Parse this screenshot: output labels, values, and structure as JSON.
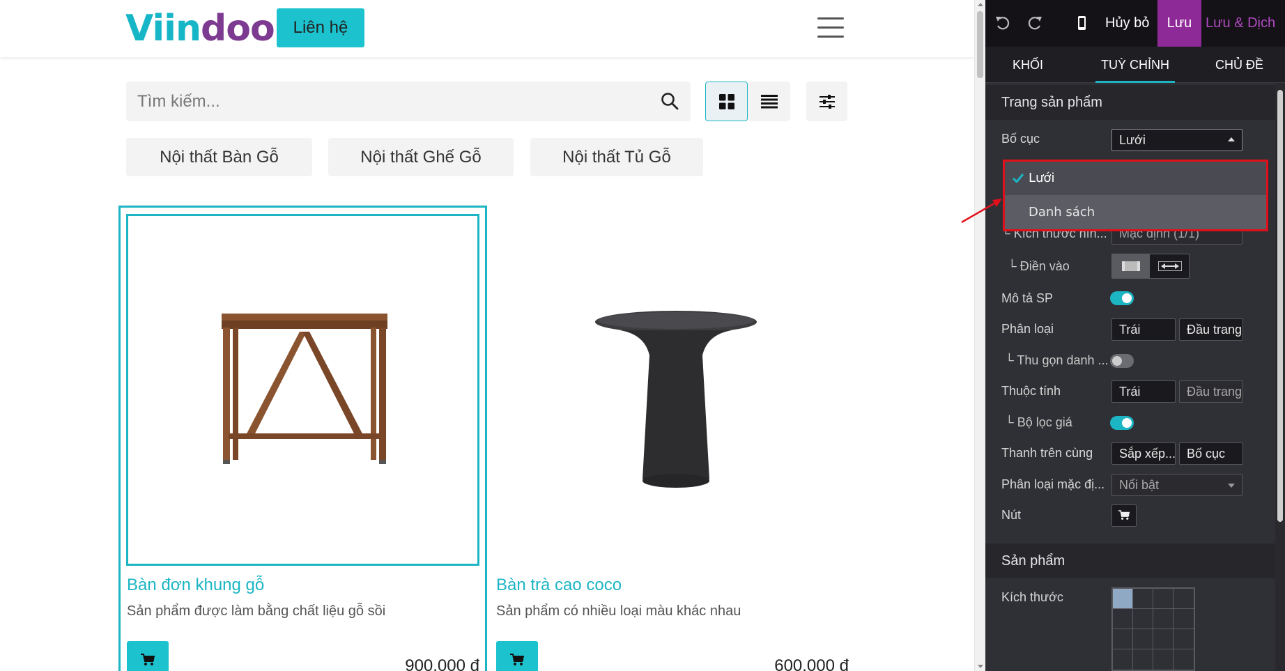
{
  "site": {
    "logo": {
      "part1": "Viin",
      "part2": "doo"
    },
    "contact_label": "Liên hệ",
    "search": {
      "placeholder": "Tìm kiếm..."
    },
    "categories": [
      "Nội thất Bàn Gỗ",
      "Nội thất Ghế Gỗ",
      "Nội thất Tủ Gỗ"
    ],
    "products": [
      {
        "name": "Bàn đơn khung gỗ",
        "desc": "Sản phẩm được làm bằng chất liệu gỗ sồi",
        "price": "900.000 đ"
      },
      {
        "name": "Bàn trà cao coco",
        "desc": "Sản phẩm có nhiều loại màu khác nhau",
        "price": "600.000 đ"
      }
    ],
    "accent_color": "#1cc3cf"
  },
  "editor": {
    "discard_label": "Hủy bỏ",
    "save_label": "Lưu",
    "save_translate_label": "Lưu & Dịch",
    "tabs": [
      "KHỐI",
      "TUỲ CHỈNH",
      "CHỦ ĐỀ"
    ],
    "active_tab": "TUỲ CHỈNH",
    "section_product_page": "Trang sản phẩm",
    "layout_label": "Bố cục",
    "layout_value": "Lưới",
    "layout_options": [
      "Lưới",
      "Danh sách"
    ],
    "image_size_label": "└ Kích thước hìn...",
    "image_size_value": "Mặc định (1/1)",
    "fill_label": "└ Điền vào",
    "desc_label": "Mô tả SP",
    "desc_on": true,
    "category_label": "Phân loại",
    "category_left": "Trái",
    "category_top": "Đầu trang",
    "collapse_label": "└ Thu gọn danh ...",
    "collapse_on": false,
    "attribute_label": "Thuộc tính",
    "attribute_left": "Trái",
    "attribute_top": "Đầu trang",
    "price_filter_label": "└ Bộ lọc giá",
    "price_filter_on": true,
    "topbar_label": "Thanh trên cùng",
    "topbar_sort": "Sắp xếp...",
    "topbar_layout": "Bố cục",
    "default_sort_label": "Phân loại mặc đị...",
    "default_sort_value": "Nổi bật",
    "button_label": "Nút",
    "section_products": "Sản phẩm",
    "size_label": "Kích thước",
    "accent": "#1cb5c4",
    "save_color": "#8e2a97"
  }
}
